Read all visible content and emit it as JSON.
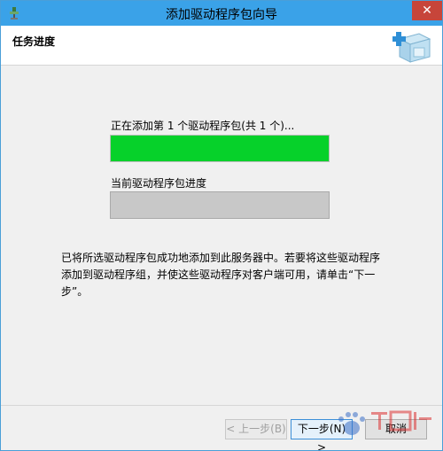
{
  "window": {
    "title": "添加驱动程序包向导",
    "close_glyph": "✕",
    "app_icon": "network-driver-icon"
  },
  "header": {
    "title": "任务进度",
    "icon": "package-add-icon"
  },
  "progress": {
    "overall_label": "正在添加第 1 个驱动程序包(共 1 个)...",
    "overall_fraction": 1.0,
    "package_label": "当前驱动程序包进度",
    "package_fraction": 0.0,
    "fill_color": "#06d12a"
  },
  "message": {
    "text": "已将所选驱动程序包成功地添加到此服务器中。若要将这些驱动程序添加到驱动程序组，并使这些驱动程序对客户端可用，请单击“下一步”。"
  },
  "buttons": {
    "prev": "< 上一步(B)",
    "next": "下一步(N) >",
    "cancel": "取消"
  }
}
